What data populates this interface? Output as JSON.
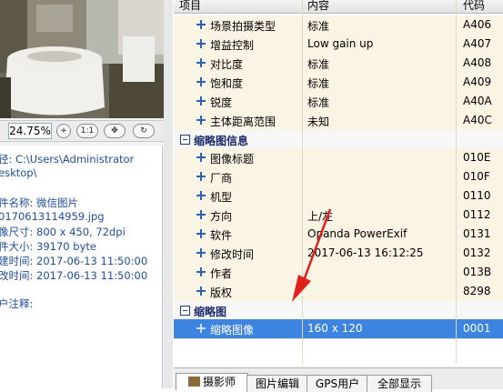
{
  "zoom": {
    "value": "24.75%",
    "zoom_in_glyph": "+",
    "one_to_one": "1:1",
    "fit_glyph": "✥",
    "rotate_glyph": "↻"
  },
  "file_info": {
    "lines": [
      "径: C:\\Users\\Administrator",
      "esktop\\",
      "",
      "件名称: 微信图片",
      "0170613114959.jpg",
      "像尺寸: 800 x 450, 72dpi",
      "件大小: 39170 byte",
      "建时间: 2017-06-13 11:50:00",
      "改时间: 2017-06-13 11:50:00",
      "",
      "户注释:"
    ]
  },
  "table": {
    "headers": [
      "项目",
      "内容",
      "代码"
    ],
    "rows": [
      {
        "kind": "row",
        "item": "场景拍摄类型",
        "value": "标准",
        "code": "A406"
      },
      {
        "kind": "row",
        "item": "增益控制",
        "value": "Low gain up",
        "code": "A407"
      },
      {
        "kind": "row",
        "item": "对比度",
        "value": "标准",
        "code": "A408"
      },
      {
        "kind": "row",
        "item": "饱和度",
        "value": "标准",
        "code": "A409"
      },
      {
        "kind": "row",
        "item": "锐度",
        "value": "标准",
        "code": "A40A"
      },
      {
        "kind": "row",
        "item": "主体距离范围",
        "value": "未知",
        "code": "A40C"
      },
      {
        "kind": "group",
        "item": "缩略图信息"
      },
      {
        "kind": "row",
        "item": "图像标题",
        "value": "",
        "code": "010E"
      },
      {
        "kind": "row",
        "item": "厂商",
        "value": "",
        "code": "010F"
      },
      {
        "kind": "row",
        "item": "机型",
        "value": "",
        "code": "0110"
      },
      {
        "kind": "row",
        "item": "方向",
        "value": "上/左",
        "code": "0112"
      },
      {
        "kind": "row",
        "item": "软件",
        "value": "Opanda PowerExif",
        "code": "0131"
      },
      {
        "kind": "row",
        "item": "修改时间",
        "value": "2017-06-13 16:12:25",
        "code": "0132"
      },
      {
        "kind": "row",
        "item": "作者",
        "value": "",
        "code": "013B"
      },
      {
        "kind": "row",
        "item": "版权",
        "value": "",
        "code": "8298"
      },
      {
        "kind": "group",
        "item": "缩略图"
      },
      {
        "kind": "row",
        "item": "缩略图像",
        "value": "160 x 120",
        "code": "0001",
        "selected": true
      }
    ]
  },
  "tabs": [
    "摄影师",
    "图片编辑",
    "GPS用户",
    "全部显示"
  ],
  "colors": {
    "selection": "#3c84e0",
    "row_bg": "#faf4e5",
    "arrow": "#e0201b",
    "link_text": "#1f4e9c"
  }
}
